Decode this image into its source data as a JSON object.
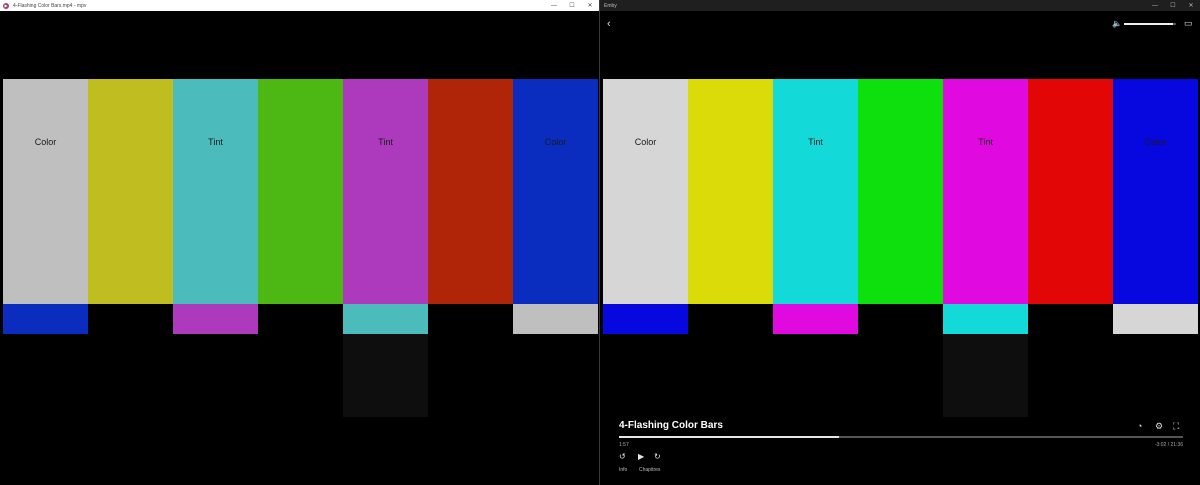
{
  "left_window": {
    "title": "4-Flashing Color Bars.mp4 - mpv",
    "controls": [
      "—",
      "☐",
      "✕"
    ]
  },
  "right_window": {
    "title": "Emby",
    "controls": [
      "—",
      "☐",
      "✕"
    ]
  },
  "left_video": {
    "top_bars": [
      {
        "color": "#bfbfbf",
        "label": "Color"
      },
      {
        "color": "#bfbd1f",
        "label": ""
      },
      {
        "color": "#4cbbbb",
        "label": "Tint"
      },
      {
        "color": "#4db714",
        "label": ""
      },
      {
        "color": "#ad39bc",
        "label": "Tint"
      },
      {
        "color": "#b02408",
        "label": ""
      },
      {
        "color": "#0a2cbf",
        "label": "Color"
      }
    ],
    "sub_bars": [
      "#0a2cbf",
      "#000000",
      "#ad39bc",
      "#000000",
      "#4cbbbb",
      "#000000",
      "#bfbfbf"
    ],
    "dark_block_color": "#0e0e0e"
  },
  "right_video": {
    "top_bars": [
      {
        "color": "#d6d6d6",
        "label": "Color"
      },
      {
        "color": "#dadb09",
        "label": ""
      },
      {
        "color": "#14d9d9",
        "label": "Tint"
      },
      {
        "color": "#0ee00e",
        "label": ""
      },
      {
        "color": "#e009e0",
        "label": "Tint"
      },
      {
        "color": "#e20606",
        "label": ""
      },
      {
        "color": "#0707e0",
        "label": "Color"
      }
    ],
    "sub_bars": [
      "#0707e0",
      "#000000",
      "#e009e0",
      "#000000",
      "#14d9d9",
      "#000000",
      "#d6d6d6"
    ],
    "dark_block_color": "#0e0e0e"
  },
  "player": {
    "title": "4-Flashing Color Bars",
    "time_current": "1:57",
    "time_right": "-3:02  /  21:36",
    "progress_fraction": 0.39,
    "volume_fraction": 0.95,
    "tabs": [
      "Info",
      "Chapitres"
    ],
    "icons": {
      "back": "‹",
      "volume": "🔈",
      "cast": "▭",
      "speed": "◔",
      "settings": "⚙",
      "fullscreen": "⛶",
      "replay": "↺",
      "play": "▶",
      "forward": "↻"
    }
  }
}
